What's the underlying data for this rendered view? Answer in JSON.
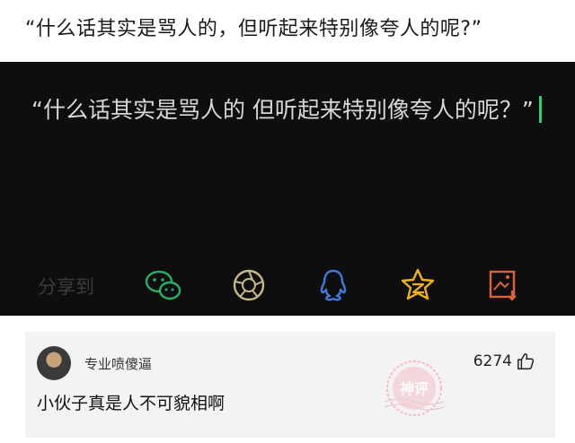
{
  "headline": "“什么话其实是骂人的，但听起来特别像夸人的呢?”",
  "card": {
    "quote": "“什么话其实是骂人的  但听起来特别像夸人的呢？”",
    "share_label": "分享到",
    "share_icons": [
      "wechat-icon",
      "moments-icon",
      "qq-icon",
      "qzone-icon",
      "save-image-icon"
    ]
  },
  "comment": {
    "username": "专业喷傻逼",
    "likes": "6274",
    "text": "小伙子真是人不可貌相啊",
    "stamp_text": "神评"
  },
  "colors": {
    "card_bg": "#0e0e0f",
    "wechat": "#2aae67",
    "moments": "#c8b88a",
    "qq": "#3d7be0",
    "qzone": "#f2b21b",
    "save": "#e0603a",
    "caret": "#2fd06e"
  }
}
